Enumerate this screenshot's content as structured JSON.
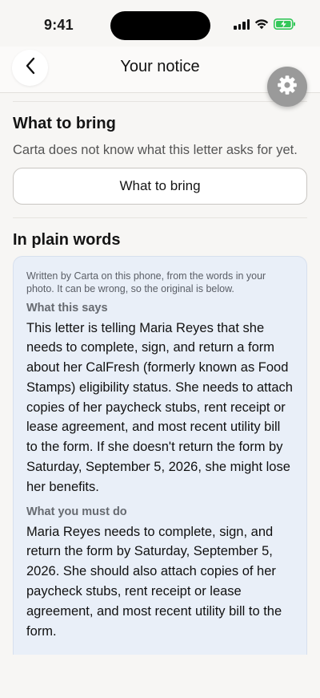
{
  "status_bar": {
    "time": "9:41"
  },
  "nav": {
    "title": "Your notice"
  },
  "what_to_bring": {
    "title": "What to bring",
    "description": "Carta does not know what this letter asks for yet.",
    "button_label": "What to bring"
  },
  "plain_words": {
    "title": "In plain words",
    "disclaimer": "Written by Carta on this phone, from the words in your photo. It can be wrong, so the original is below.",
    "what_this_says_label": "What this says",
    "what_this_says": "This letter is telling Maria Reyes that she needs to complete, sign, and return a form about her CalFresh (formerly known as Food Stamps) eligibility status. She needs to attach copies of her paycheck stubs, rent receipt or lease agreement, and most recent utility bill to the form. If she doesn't return the form by Saturday, September 5, 2026, she might lose her benefits.",
    "what_you_must_do_label": "What you must do",
    "what_you_must_do": "Maria Reyes needs to complete, sign, and return the form by Saturday, September 5, 2026. She should also attach copies of her paycheck stubs, rent receipt or lease agreement, and most recent utility bill to the form."
  },
  "colors": {
    "card_background": "#e9eff8",
    "battery_green": "#34c759",
    "gear_button": "#9a9a9a"
  },
  "icons": [
    "back-chevron-icon",
    "gear-icon",
    "signal-icon",
    "wifi-icon",
    "battery-charging-icon"
  ]
}
